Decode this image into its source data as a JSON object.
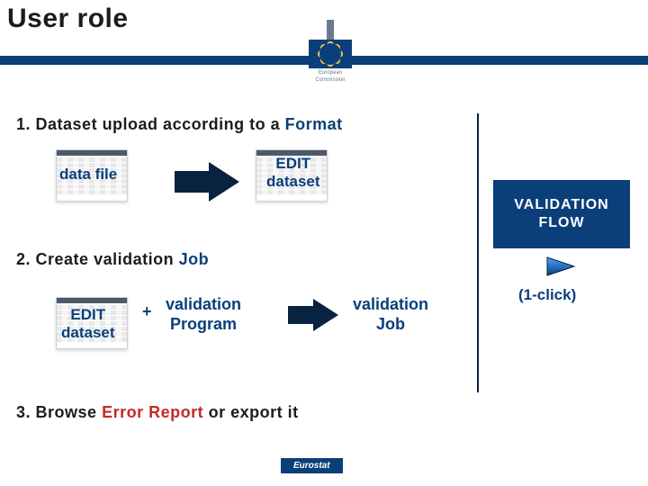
{
  "title": "User role",
  "logo_caption_top": "European",
  "logo_caption_bottom": "Commission",
  "sections": {
    "s1": {
      "num": "1.",
      "pre": " Dataset upload according to a ",
      "accent": "Format"
    },
    "s2": {
      "num": "2.",
      "pre": " Create validation ",
      "accent": "Job"
    },
    "s3": {
      "num": "3.",
      "pre": " Browse ",
      "accent": "Error Report",
      "post": " or export it"
    }
  },
  "labels": {
    "data_file": "data file",
    "edit_dataset_l1": "EDIT",
    "edit_dataset_l2": "dataset",
    "plus": "+",
    "validation": "validation",
    "program": "Program",
    "job": "Job"
  },
  "vflow": {
    "l1": "VALIDATION",
    "l2": "FLOW"
  },
  "oneclick": "(1-click)",
  "footer": "Eurostat"
}
